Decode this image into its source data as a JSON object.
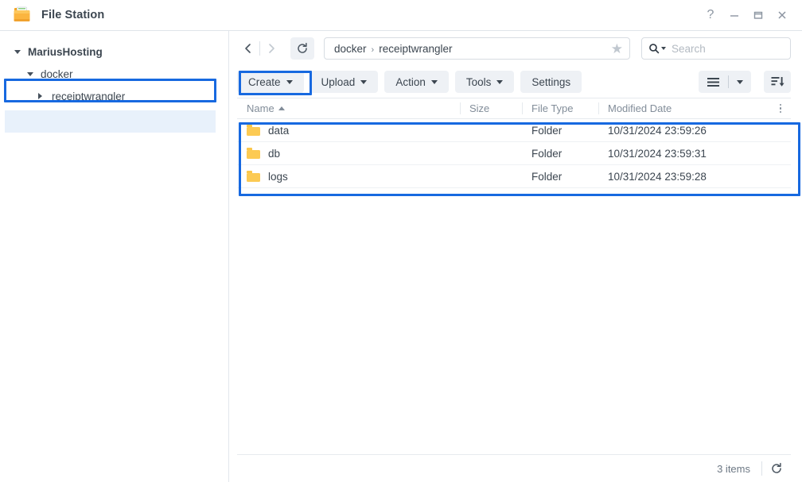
{
  "window": {
    "title": "File Station",
    "app_icon": "folder-icon",
    "controls": [
      {
        "name": "help-button",
        "glyph": "?"
      },
      {
        "name": "minimize-button",
        "glyph": "minimize-icon"
      },
      {
        "name": "maximize-button",
        "glyph": "maximize-icon"
      },
      {
        "name": "close-button",
        "glyph": "close-icon"
      }
    ]
  },
  "sidebar": {
    "items": [
      {
        "label": "MariusHosting",
        "level": 0,
        "caret": "chevron-down-icon",
        "expanded": true,
        "selected": false
      },
      {
        "label": "docker",
        "level": 1,
        "caret": "chevron-down-icon",
        "expanded": true,
        "selected": false
      },
      {
        "label": "receiptwrangler",
        "level": 2,
        "caret": "chevron-right-icon",
        "expanded": false,
        "selected": true
      }
    ]
  },
  "navbar": {
    "back_icon": "chevron-left-icon",
    "forward_icon": "chevron-right-icon",
    "refresh_icon": "refresh-icon",
    "path_segments": [
      "docker",
      "receiptwrangler"
    ],
    "path_separator": "›",
    "favorite_icon": "star-icon",
    "search": {
      "placeholder": "Search",
      "value": "",
      "icon": "search-icon"
    }
  },
  "toolbar": {
    "buttons": [
      {
        "label": "Create",
        "dropdown": true,
        "highlighted": true
      },
      {
        "label": "Upload",
        "dropdown": true,
        "highlighted": false
      },
      {
        "label": "Action",
        "dropdown": true,
        "highlighted": false
      },
      {
        "label": "Tools",
        "dropdown": true,
        "highlighted": false
      },
      {
        "label": "Settings",
        "dropdown": false,
        "highlighted": false
      }
    ],
    "view_mode_icon": "list-view-icon",
    "view_mode_caret": "chevron-down-icon",
    "sort_icon": "sort-descending-icon"
  },
  "file_list": {
    "columns": [
      {
        "key": "name",
        "label": "Name",
        "sorted": "asc"
      },
      {
        "key": "size",
        "label": "Size",
        "sorted": ""
      },
      {
        "key": "type",
        "label": "File Type",
        "sorted": ""
      },
      {
        "key": "date",
        "label": "Modified Date",
        "sorted": ""
      }
    ],
    "column_menu_icon": "kebab-menu-icon",
    "rows": [
      {
        "icon": "folder-icon",
        "name": "data",
        "size": "",
        "type": "Folder",
        "date": "10/31/2024 23:59:26"
      },
      {
        "icon": "folder-icon",
        "name": "db",
        "size": "",
        "type": "Folder",
        "date": "10/31/2024 23:59:31"
      },
      {
        "icon": "folder-icon",
        "name": "logs",
        "size": "",
        "type": "Folder",
        "date": "10/31/2024 23:59:28"
      }
    ]
  },
  "statusbar": {
    "count_text": "3 items",
    "refresh_icon": "refresh-icon"
  },
  "highlights": {
    "color": "#1769e0",
    "regions": [
      "sidebar-selected-item",
      "create-button",
      "file-list-rows"
    ]
  }
}
